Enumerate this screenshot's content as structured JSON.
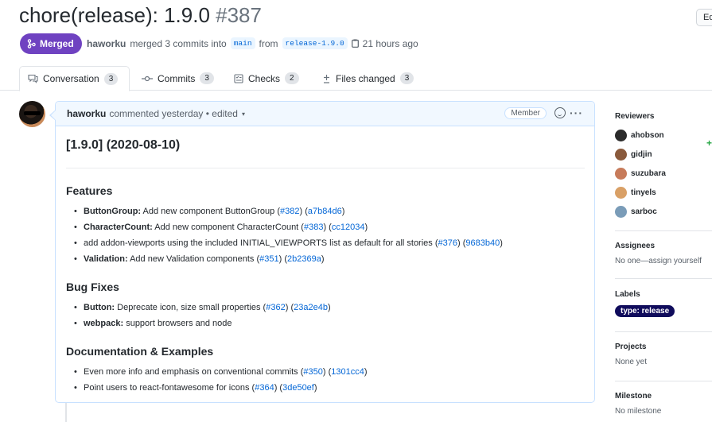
{
  "pr": {
    "title": "chore(release): 1.9.0",
    "number": "#387",
    "edit_label": "Ed",
    "state_label": "Merged",
    "author": "haworku",
    "merged_text": "merged 3 commits into",
    "base_branch": "main",
    "from_text": "from",
    "head_branch": "release-1.9.0",
    "time": "21 hours ago"
  },
  "tabs": [
    {
      "label": "Conversation",
      "count": "3",
      "icon": "comment-icon"
    },
    {
      "label": "Commits",
      "count": "3",
      "icon": "commit-icon"
    },
    {
      "label": "Checks",
      "count": "2",
      "icon": "checklist-icon"
    },
    {
      "label": "Files changed",
      "count": "3",
      "icon": "plus-minus-icon"
    }
  ],
  "diffstat_plus": "+",
  "comment": {
    "author": "haworku",
    "meta": "commented yesterday • edited",
    "role": "Member",
    "release_heading": "[1.9.0] (2020-08-10)",
    "sections": [
      {
        "heading": "Features",
        "items": [
          {
            "bold": "ButtonGroup:",
            "text": " Add new component ButtonGroup (",
            "pr": "#382",
            "mid": ") (",
            "sha": "a7b84d6",
            "end": ")"
          },
          {
            "bold": "CharacterCount:",
            "text": " Add new component CharacterCount (",
            "pr": "#383",
            "mid": ") (",
            "sha": "cc12034",
            "end": ")"
          },
          {
            "bold": "",
            "text": "add addon-viewports using the included INITIAL_VIEWPORTS list as default for all stories (",
            "pr": "#376",
            "mid": ") (",
            "sha": "9683b40",
            "end": ")"
          },
          {
            "bold": "Validation:",
            "text": " Add new Validation components (",
            "pr": "#351",
            "mid": ") (",
            "sha": "2b2369a",
            "end": ")"
          }
        ]
      },
      {
        "heading": "Bug Fixes",
        "items": [
          {
            "bold": "Button:",
            "text": " Deprecate icon, size small properties (",
            "pr": "#362",
            "mid": ") (",
            "sha": "23a2e4b",
            "end": ")"
          },
          {
            "bold": "webpack:",
            "text": " support browsers and node",
            "pr": "",
            "mid": "",
            "sha": "",
            "end": ""
          }
        ]
      },
      {
        "heading": "Documentation & Examples",
        "items": [
          {
            "bold": "",
            "text": "Even more info and emphasis on conventional commits (",
            "pr": "#350",
            "mid": ") (",
            "sha": "1301cc4",
            "end": ")"
          },
          {
            "bold": "",
            "text": "Point users to react-fontawesome for icons (",
            "pr": "#364",
            "mid": ") (",
            "sha": "3de50ef",
            "end": ")"
          }
        ]
      }
    ]
  },
  "sidebar": {
    "reviewers_title": "Reviewers",
    "reviewers": [
      {
        "name": "ahobson",
        "color": "#2b2b2b"
      },
      {
        "name": "gidjin",
        "color": "#8a5a3c"
      },
      {
        "name": "suzubara",
        "color": "#c77b5a"
      },
      {
        "name": "tinyels",
        "color": "#d9a066"
      },
      {
        "name": "sarboc",
        "color": "#7a9cb8"
      }
    ],
    "assignees_title": "Assignees",
    "assignees_text": "No one—assign yourself",
    "labels_title": "Labels",
    "label": "type: release",
    "label_color": "#100c5c",
    "projects_title": "Projects",
    "projects_text": "None yet",
    "milestone_title": "Milestone",
    "milestone_text": "No milestone"
  },
  "colors": {
    "merged": "#6f42c1",
    "link": "#0366d6"
  }
}
